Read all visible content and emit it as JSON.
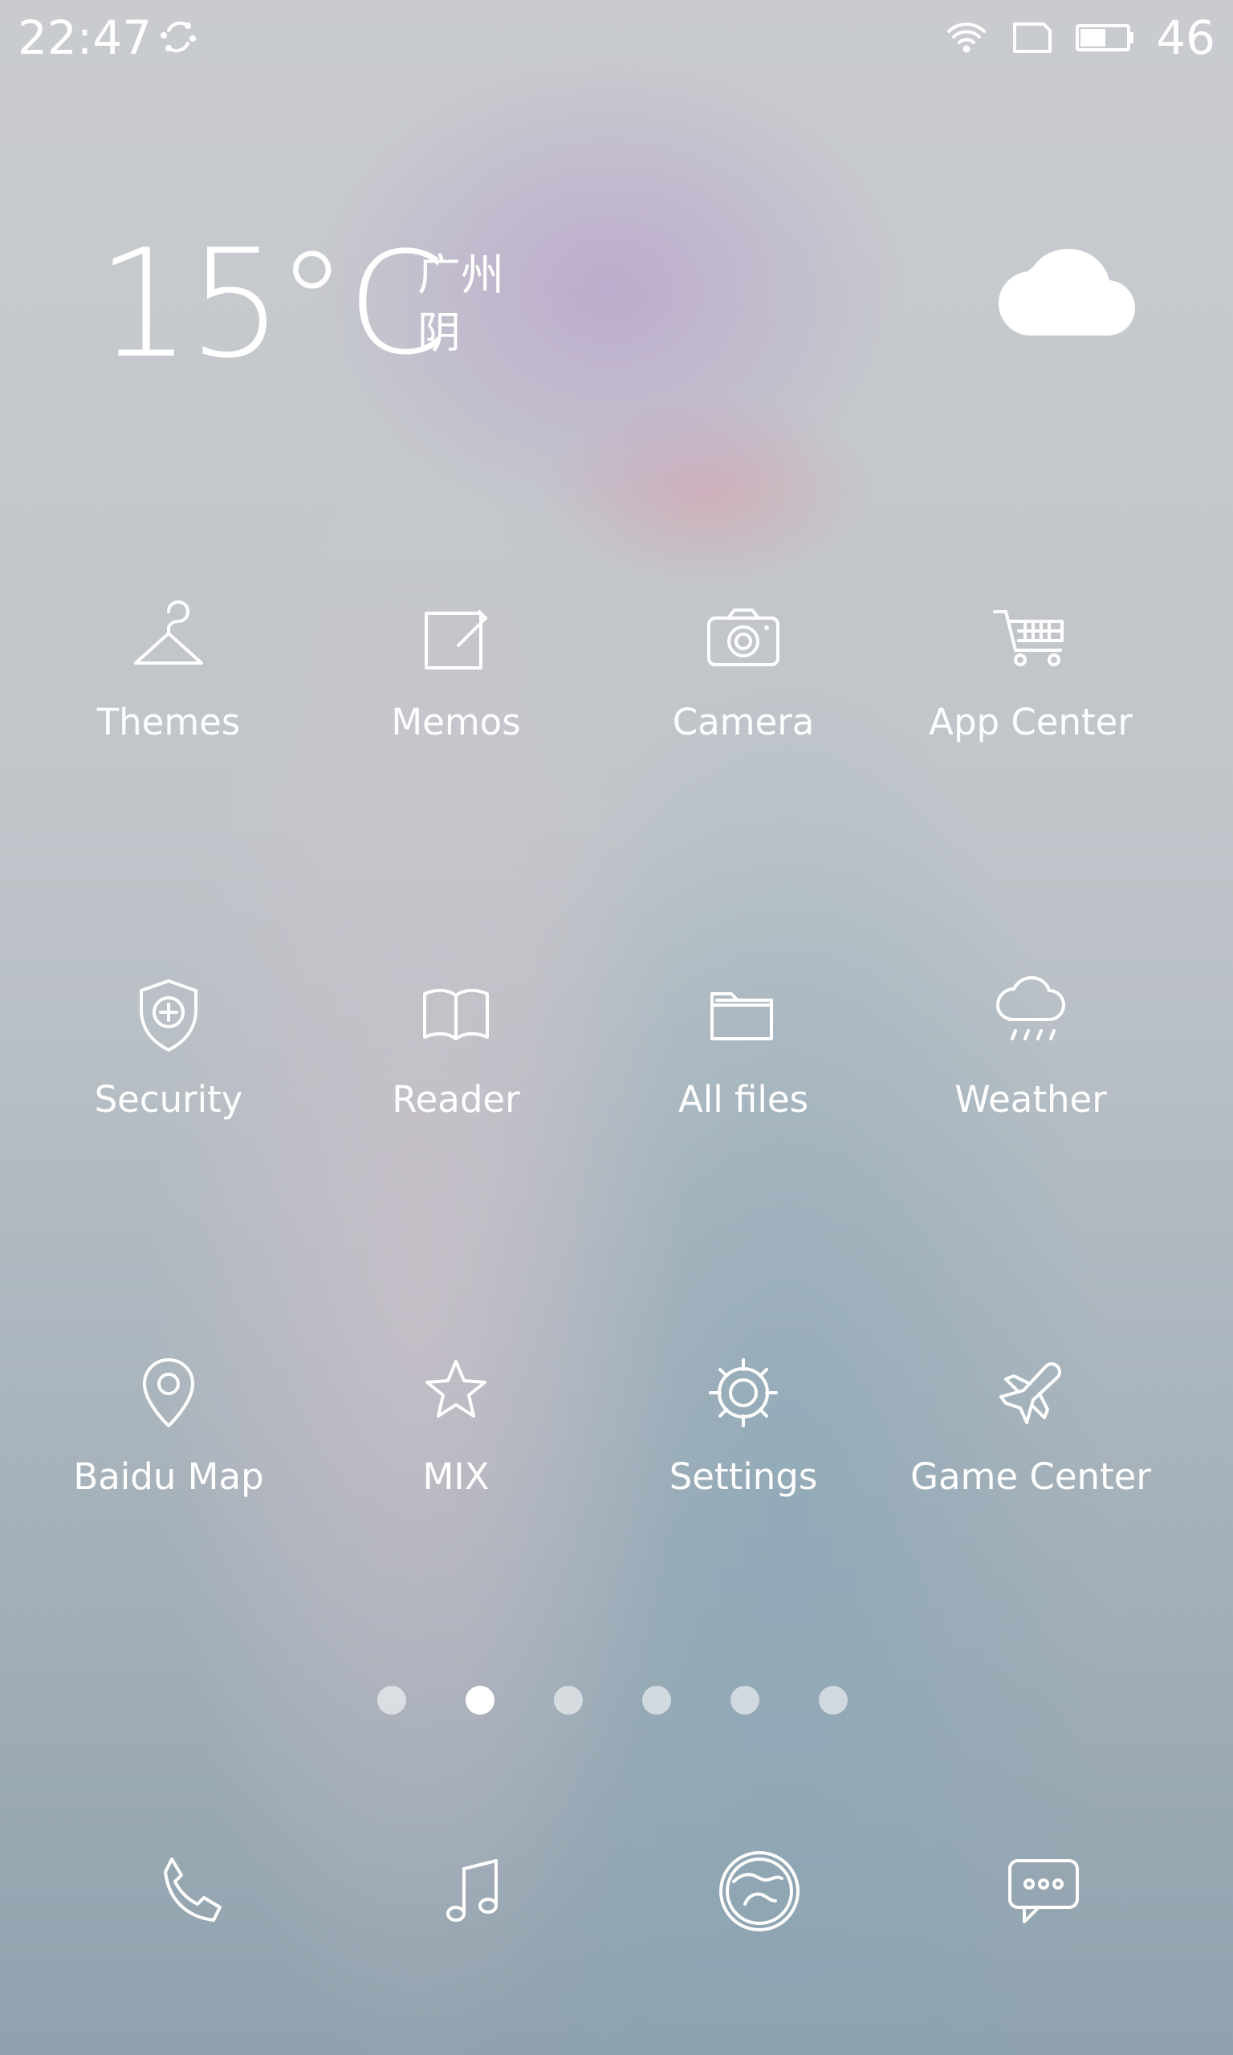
{
  "status_bar": {
    "time": "22:47",
    "battery": "46"
  },
  "weather_widget": {
    "temperature": "15",
    "unit": "°C",
    "city": "广州",
    "condition": "阴"
  },
  "apps": [
    {
      "label": "Themes",
      "icon": "hanger-icon"
    },
    {
      "label": "Memos",
      "icon": "edit-icon"
    },
    {
      "label": "Camera",
      "icon": "camera-icon"
    },
    {
      "label": "App Center",
      "icon": "shopping-cart-icon"
    },
    {
      "label": "Security",
      "icon": "shield-icon"
    },
    {
      "label": "Reader",
      "icon": "book-icon"
    },
    {
      "label": "All files",
      "icon": "folder-icon"
    },
    {
      "label": "Weather",
      "icon": "weather-icon"
    },
    {
      "label": "Baidu Map",
      "icon": "map-pin-icon"
    },
    {
      "label": "MIX",
      "icon": "star-icon"
    },
    {
      "label": "Settings",
      "icon": "gear-icon"
    },
    {
      "label": "Game Center",
      "icon": "airplane-icon"
    }
  ],
  "page_indicator": {
    "count": 6,
    "active_index": 1
  },
  "dock": [
    {
      "icon": "phone-icon"
    },
    {
      "icon": "music-icon"
    },
    {
      "icon": "browser-icon"
    },
    {
      "icon": "messages-icon"
    }
  ],
  "colors": {
    "foreground": "#ffffff",
    "active_dot": "#ffffff",
    "inactive_dot": "rgba(255,255,255,0.56)"
  }
}
